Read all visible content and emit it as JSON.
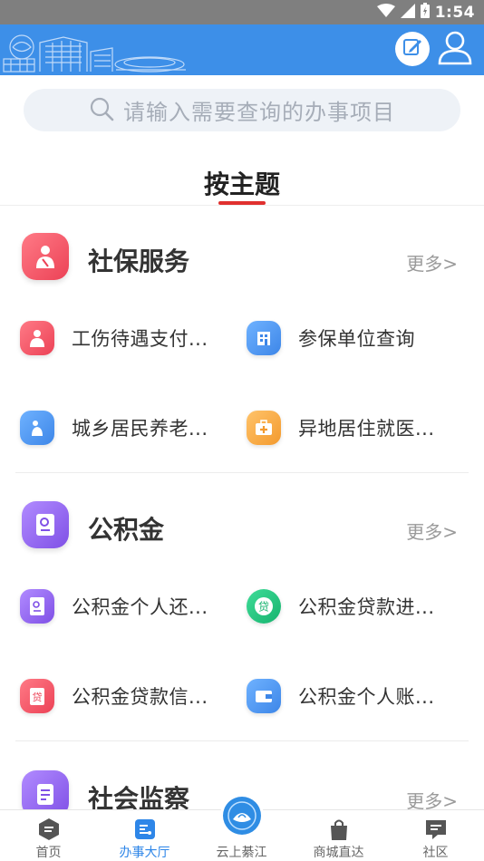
{
  "status_bar": {
    "time": "1:54"
  },
  "header": {
    "edit_icon": "edit-icon",
    "user_icon": "user-icon"
  },
  "search": {
    "placeholder": "请输入需要查询的办事项目"
  },
  "section_tab": {
    "label": "按主题"
  },
  "categories": [
    {
      "title": "社保服务",
      "more": "更多>",
      "color": "#f0566a",
      "items": [
        {
          "label": "工伤待遇支付...",
          "color": "#f0566a",
          "icon": "injury-icon"
        },
        {
          "label": "参保单位查询",
          "color": "#4a97ef",
          "icon": "building-icon"
        },
        {
          "label": "城乡居民养老...",
          "color": "#4a97ef",
          "icon": "elder-icon"
        },
        {
          "label": "异地居住就医...",
          "color": "#f5a63f",
          "icon": "medical-kit-icon"
        }
      ]
    },
    {
      "title": "公积金",
      "more": "更多>",
      "color": "#9466ea",
      "items": [
        {
          "label": "公积金个人还...",
          "color": "#9466ea",
          "icon": "document-icon"
        },
        {
          "label": "公积金贷款进...",
          "color": "#22c07e",
          "icon": "loan-icon"
        },
        {
          "label": "公积金贷款信...",
          "color": "#f0566a",
          "icon": "loan-info-icon"
        },
        {
          "label": "公积金个人账...",
          "color": "#4a97ef",
          "icon": "wallet-icon"
        }
      ]
    },
    {
      "title": "社会监察",
      "more": "更多>",
      "color": "#9466ea",
      "items": []
    }
  ],
  "tabbar": {
    "items": [
      {
        "label": "首页",
        "icon": "home-icon"
      },
      {
        "label": "办事大厅",
        "icon": "service-hall-icon",
        "active": true
      },
      {
        "label": "云上綦江",
        "icon": "yunshang-logo-icon"
      },
      {
        "label": "商城直达",
        "icon": "shopping-bag-icon"
      },
      {
        "label": "社区",
        "icon": "chat-icon"
      }
    ],
    "active_color": "#2e86e8"
  }
}
